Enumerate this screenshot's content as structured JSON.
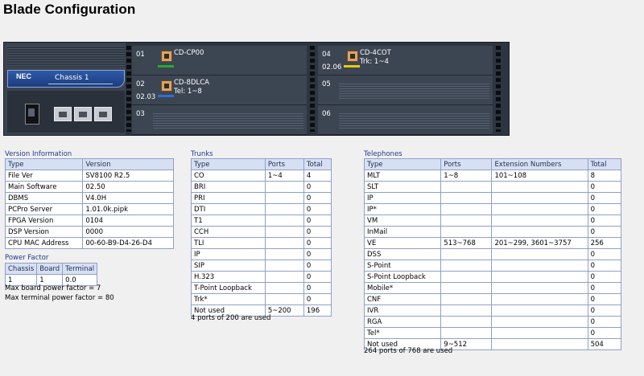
{
  "page": {
    "title": "Blade Configuration"
  },
  "chassis": {
    "brand": "NEC",
    "name": "Chassis 1",
    "slots": [
      {
        "num": "01",
        "sub": "",
        "card": "CD-CP00",
        "detail": "",
        "led": "#22aa33"
      },
      {
        "num": "02",
        "sub": "02.03",
        "card": "CD-8DLCA",
        "detail": "Tel: 1~8",
        "led": "#2f6fd6"
      },
      {
        "num": "03",
        "sub": "",
        "card": "",
        "detail": "",
        "led": ""
      },
      {
        "num": "04",
        "sub": "02.06",
        "card": "CD-4COT",
        "detail": "Trk: 1~4",
        "led": "#e8c814"
      },
      {
        "num": "05",
        "sub": "",
        "card": "",
        "detail": "",
        "led": ""
      },
      {
        "num": "06",
        "sub": "",
        "card": "",
        "detail": "",
        "led": ""
      }
    ]
  },
  "version": {
    "title": "Version Information",
    "headers": [
      "Type",
      "Version"
    ],
    "rows": [
      [
        "File Ver",
        "SV8100 R2.5"
      ],
      [
        "Main Software",
        "02.50"
      ],
      [
        "DBMS",
        "V4.0H"
      ],
      [
        "PCPro Server",
        "1.01.0k.pipk"
      ],
      [
        "FPGA Version",
        "0104"
      ],
      [
        "DSP Version",
        "0000"
      ],
      [
        "CPU MAC Address",
        "00-60-B9-D4-26-D4"
      ]
    ]
  },
  "power": {
    "title": "Power Factor",
    "headers": [
      "Chassis",
      "Board",
      "Terminal"
    ],
    "rows": [
      [
        "1",
        "1",
        "0.0"
      ]
    ],
    "note1": "Max board power factor = 7",
    "note2": "Max terminal power factor = 80"
  },
  "trunks": {
    "title": "Trunks",
    "headers": [
      "Type",
      "Ports",
      "Total"
    ],
    "rows": [
      [
        "CO",
        "1~4",
        "4"
      ],
      [
        "BRI",
        "",
        "0"
      ],
      [
        "PRI",
        "",
        "0"
      ],
      [
        "DTI",
        "",
        "0"
      ],
      [
        "T1",
        "",
        "0"
      ],
      [
        "CCH",
        "",
        "0"
      ],
      [
        "TLI",
        "",
        "0"
      ],
      [
        "IP",
        "",
        "0"
      ],
      [
        "SIP",
        "",
        "0"
      ],
      [
        "H.323",
        "",
        "0"
      ],
      [
        "T-Point Loopback",
        "",
        "0"
      ],
      [
        "Trk*",
        "",
        "0"
      ],
      [
        "Not used",
        "5~200",
        "196"
      ]
    ],
    "summary": "4 ports of 200 are used"
  },
  "telephones": {
    "title": "Telephones",
    "headers": [
      "Type",
      "Ports",
      "Extension Numbers",
      "Total"
    ],
    "rows": [
      [
        "MLT",
        "1~8",
        "101~108",
        "8"
      ],
      [
        "SLT",
        "",
        "",
        "0"
      ],
      [
        "IP",
        "",
        "",
        "0"
      ],
      [
        "IP*",
        "",
        "",
        "0"
      ],
      [
        "VM",
        "",
        "",
        "0"
      ],
      [
        "InMail",
        "",
        "",
        "0"
      ],
      [
        "VE",
        "513~768",
        "201~299, 3601~3757",
        "256"
      ],
      [
        "DSS",
        "",
        "",
        "0"
      ],
      [
        "S-Point",
        "",
        "",
        "0"
      ],
      [
        "S-Point Loopback",
        "",
        "",
        "0"
      ],
      [
        "Mobile*",
        "",
        "",
        "0"
      ],
      [
        "CNF",
        "",
        "",
        "0"
      ],
      [
        "IVR",
        "",
        "",
        "0"
      ],
      [
        "RGA",
        "",
        "",
        "0"
      ],
      [
        "Tel*",
        "",
        "",
        "0"
      ],
      [
        "Not used",
        "9~512",
        "",
        "504"
      ]
    ],
    "summary": "264 ports of 768 are used"
  }
}
